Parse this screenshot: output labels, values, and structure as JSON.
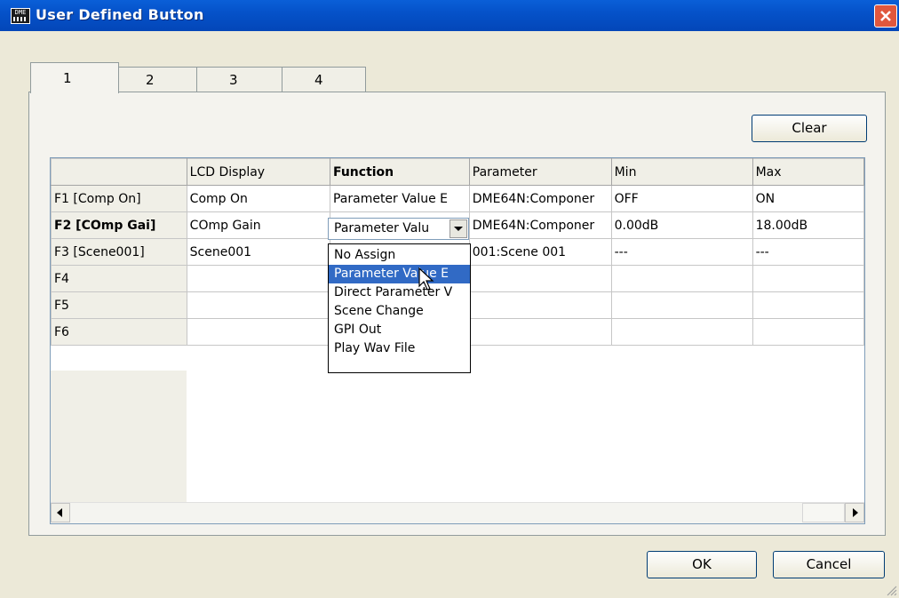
{
  "window": {
    "title": "User Defined Button",
    "icon": "dme-app-icon",
    "icon_text": "DME"
  },
  "tabs": [
    {
      "label": "1",
      "active": true
    },
    {
      "label": "2",
      "active": false
    },
    {
      "label": "3",
      "active": false
    },
    {
      "label": "4",
      "active": false
    }
  ],
  "clear_button": "Clear",
  "grid": {
    "columns": [
      "",
      "LCD Display",
      "Function",
      "Parameter",
      "Min",
      "Max"
    ],
    "rows": [
      {
        "header": "F1 [Comp On]",
        "lcd": "Comp On",
        "function": "Parameter Value E",
        "parameter": "DME64N:Componer",
        "min": "OFF",
        "max": "ON"
      },
      {
        "header": "F2 [COmp Gai]",
        "lcd": "COmp Gain",
        "function": "Parameter Valu",
        "parameter": "DME64N:Componer",
        "min": "0.00dB",
        "max": "18.00dB"
      },
      {
        "header": "F3 [Scene001]",
        "lcd": "Scene001",
        "function": "",
        "parameter": "001:Scene 001",
        "min": "---",
        "max": "---"
      },
      {
        "header": "F4",
        "lcd": "",
        "function": "",
        "parameter": "",
        "min": "",
        "max": ""
      },
      {
        "header": "F5",
        "lcd": "",
        "function": "",
        "parameter": "",
        "min": "",
        "max": ""
      },
      {
        "header": "F6",
        "lcd": "",
        "function": "",
        "parameter": "",
        "min": "",
        "max": ""
      }
    ]
  },
  "function_dropdown": {
    "value": "Parameter Valu",
    "options": [
      "No Assign",
      "Parameter Value E",
      "Direct Parameter V",
      "Scene Change",
      "GPI Out",
      "Play Wav File"
    ],
    "highlighted_index": 1
  },
  "ok_button": "OK",
  "cancel_button": "Cancel",
  "colors": {
    "titlebar": "#0552c9",
    "highlight": "#316ac5",
    "close": "#e0573d"
  }
}
